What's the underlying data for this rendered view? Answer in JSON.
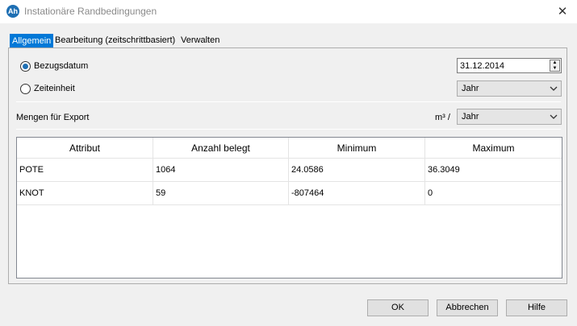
{
  "window": {
    "title": "Instationäre Randbedingungen",
    "icon_text": "Ah",
    "close_glyph": "✕"
  },
  "tabs": [
    {
      "label": "Allgemein",
      "active": true
    },
    {
      "label": "Bearbeitung (zeitschrittbasiert)",
      "active": false
    },
    {
      "label": "Verwalten",
      "active": false
    }
  ],
  "options": {
    "bezugsdatum_label": "Bezugsdatum",
    "bezugsdatum_checked": true,
    "zeiteinheit_label": "Zeiteinheit",
    "zeiteinheit_checked": false,
    "date_value": "31.12.2014",
    "zeiteinheit_value": "Jahr"
  },
  "export": {
    "label": "Mengen für Export",
    "unit": "m³ /",
    "period_value": "Jahr"
  },
  "table": {
    "columns": [
      "Attribut",
      "Anzahl belegt",
      "Minimum",
      "Maximum"
    ],
    "rows": [
      [
        "POTE",
        "1064",
        "24.0586",
        "36.3049"
      ],
      [
        "KNOT",
        "59",
        "-807464",
        "0"
      ]
    ]
  },
  "buttons": {
    "ok": "OK",
    "cancel": "Abbrechen",
    "help": "Hilfe"
  },
  "colors": {
    "accent": "#0078d7",
    "window_bg": "#f0f0f0"
  }
}
